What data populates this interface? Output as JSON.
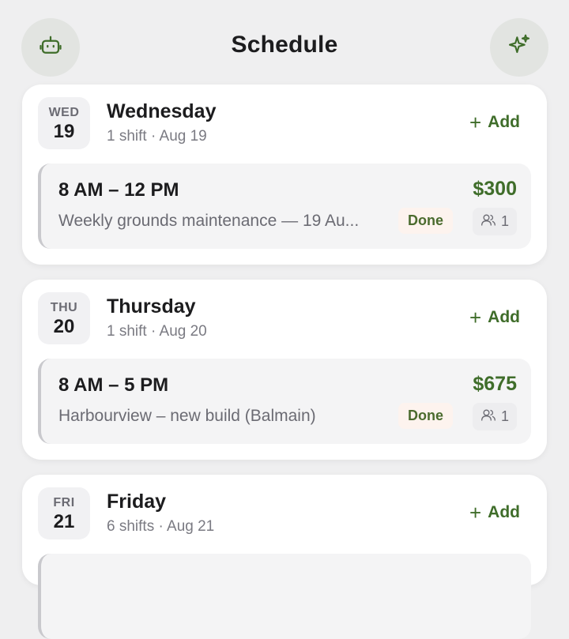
{
  "header": {
    "title": "Schedule",
    "left_icon": "robot-icon",
    "right_icon": "sparkles-icon"
  },
  "colors": {
    "accent": "#3f6d2a",
    "background": "#efeff0"
  },
  "days": [
    {
      "dow": "WED",
      "num": "19",
      "name": "Wednesday",
      "sub": "1 shift · Aug 19",
      "add_label": "Add",
      "shifts": [
        {
          "time": "8 AM – 12 PM",
          "price": "$300",
          "desc": "Weekly grounds maintenance — 19 Au...",
          "status": "Done",
          "crew": "1"
        }
      ]
    },
    {
      "dow": "THU",
      "num": "20",
      "name": "Thursday",
      "sub": "1 shift · Aug 20",
      "add_label": "Add",
      "shifts": [
        {
          "time": "8 AM – 5 PM",
          "price": "$675",
          "desc": "Harbourview – new build (Balmain)",
          "status": "Done",
          "crew": "1"
        }
      ]
    },
    {
      "dow": "FRI",
      "num": "21",
      "name": "Friday",
      "sub": "6 shifts · Aug 21",
      "add_label": "Add",
      "shifts": []
    }
  ]
}
